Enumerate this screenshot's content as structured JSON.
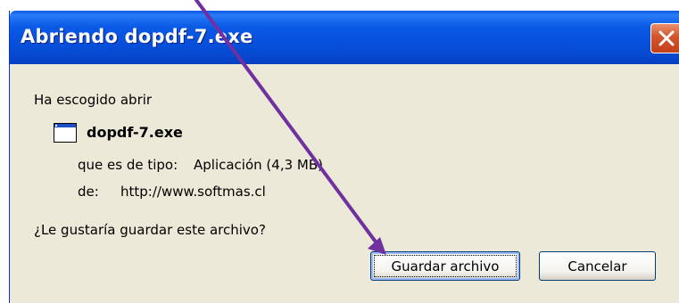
{
  "dialog": {
    "title": "Abriendo dopdf-7.exe",
    "intro": "Ha escogido abrir",
    "file": {
      "name": "dopdf-7.exe",
      "icon": "application-window-icon",
      "type_label": "que es de tipo:",
      "type_value": "Aplicación (4,3 MB)",
      "from_label": "de:",
      "from_value": "http://www.softmas.cl"
    },
    "question": "¿Le gustaría guardar este archivo?",
    "buttons": {
      "save": "Guardar archivo",
      "cancel": "Cancelar"
    }
  },
  "colors": {
    "titlebar": "#0a5ae6",
    "dialog_bg": "#ece9d8",
    "close_button": "#d2542c",
    "annotation_arrow": "#7030a0"
  },
  "annotation": {
    "type": "arrow",
    "points_to": "save-file-button"
  }
}
